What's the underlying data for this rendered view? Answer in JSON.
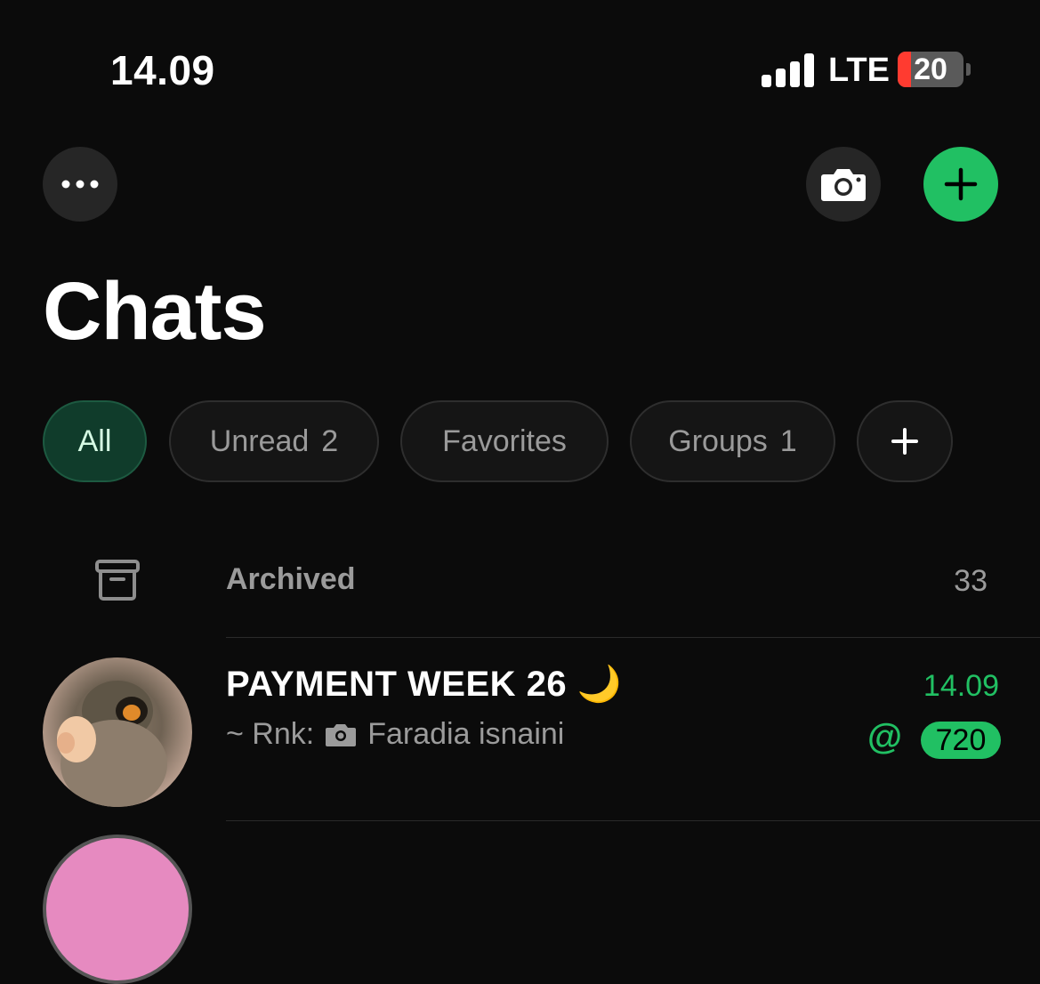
{
  "status_bar": {
    "time": "14.09",
    "network": "LTE",
    "battery_level": "20",
    "battery_fraction": 0.2
  },
  "header": {
    "title": "Chats"
  },
  "filters": [
    {
      "label": "All",
      "count": "",
      "active": true
    },
    {
      "label": "Unread",
      "count": "2",
      "active": false
    },
    {
      "label": "Favorites",
      "count": "",
      "active": false
    },
    {
      "label": "Groups",
      "count": "1",
      "active": false
    }
  ],
  "archived": {
    "label": "Archived",
    "count": "33"
  },
  "chats": [
    {
      "name": "PAYMENT WEEK 26 🌙",
      "sender": "~ Rnk:",
      "preview": "Faradia isnaini",
      "time": "14.09",
      "mention": "@",
      "unread": "720"
    }
  ],
  "colors": {
    "accent": "#21c063",
    "background": "#0b0b0b",
    "chip_active_bg": "#103c2b"
  },
  "icons": [
    "more-icon",
    "camera-icon",
    "plus-icon",
    "archive-icon",
    "photo-icon"
  ]
}
